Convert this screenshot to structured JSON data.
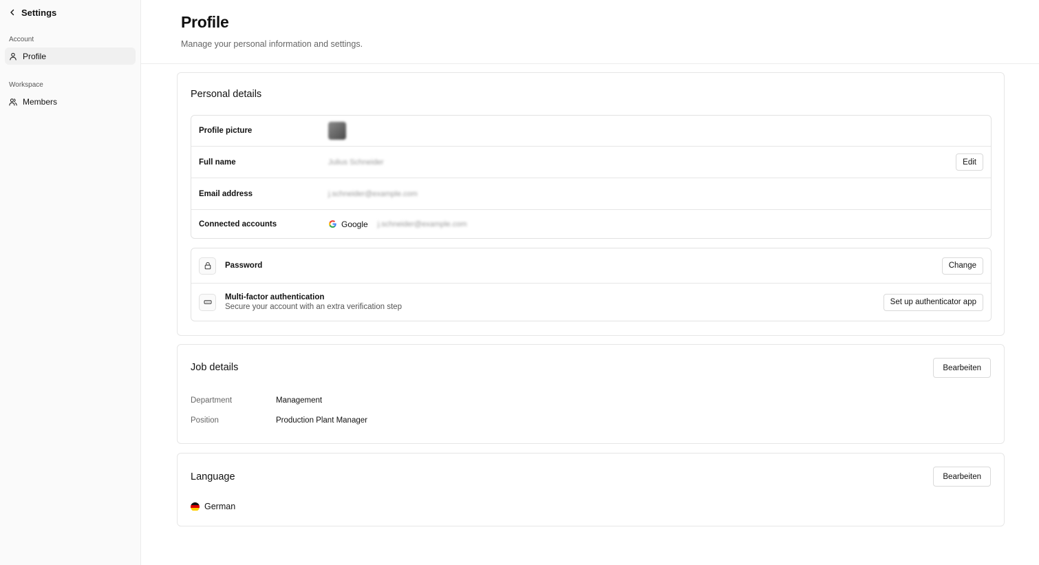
{
  "sidebar": {
    "back_label": "Settings",
    "sections": [
      {
        "label": "Account",
        "items": [
          {
            "label": "Profile",
            "icon": "user-icon",
            "active": true
          }
        ]
      },
      {
        "label": "Workspace",
        "items": [
          {
            "label": "Members",
            "icon": "users-icon",
            "active": false
          }
        ]
      }
    ]
  },
  "header": {
    "title": "Profile",
    "subtitle": "Manage your personal information and settings."
  },
  "personal": {
    "title": "Personal details",
    "rows": {
      "picture_label": "Profile picture",
      "name_label": "Full name",
      "name_value": "Julius Schneider",
      "edit_label": "Edit",
      "email_label": "Email address",
      "email_value": "j.schneider@example.com",
      "connected_label": "Connected accounts",
      "provider": "Google",
      "provider_email": "j.schneider@example.com"
    },
    "security": {
      "password_label": "Password",
      "change_label": "Change",
      "mfa_title": "Multi-factor authentication",
      "mfa_desc": "Secure your account with an extra verification step",
      "mfa_button": "Set up authenticator app"
    }
  },
  "job": {
    "title": "Job details",
    "edit_label": "Bearbeiten",
    "department_key": "Department",
    "department_value": "Management",
    "position_key": "Position",
    "position_value": "Production Plant Manager"
  },
  "language": {
    "title": "Language",
    "edit_label": "Bearbeiten",
    "value": "German"
  },
  "colors": {
    "sidebar_bg": "#fafafa",
    "border": "#e6e6e6",
    "text": "#111111",
    "muted": "#666666"
  }
}
